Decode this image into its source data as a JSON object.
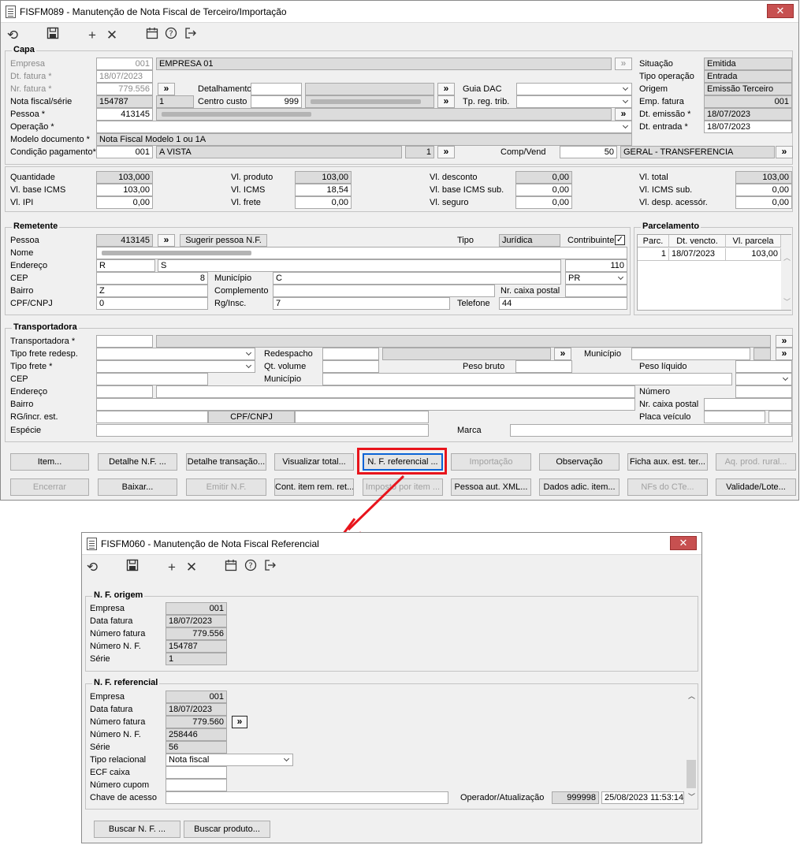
{
  "main_window": {
    "title": "FISFM089 - Manutenção de Nota Fiscal de Terceiro/Importação",
    "close_label": "✕",
    "toolbar": [
      "undo-icon",
      "save-icon",
      "add-icon",
      "delete-icon",
      "calendar-icon",
      "help-icon",
      "exit-icon"
    ],
    "capa": {
      "label": "Capa",
      "empresa_label": "Empresa",
      "empresa": "001",
      "empresa_nome": "EMPRESA 01",
      "dt_fatura_label": "Dt. fatura *",
      "dt_fatura": "18/07/2023",
      "nr_fatura_label": "Nr. fatura *",
      "nr_fatura": "779.556",
      "nota_serie_label": "Nota fiscal/série",
      "nota": "154787",
      "serie": "1",
      "pessoa_label": "Pessoa *",
      "pessoa": "413145",
      "operacao_label": "Operação *",
      "modelo_label": "Modelo documento *",
      "modelo": "Nota Fiscal Modelo 1 ou 1A",
      "condicao_label": "Condição pagamento*",
      "condicao": "001",
      "condicao_nome": "A VISTA",
      "condicao_num": "1",
      "detalhamento_label": "Detalhamento",
      "centro_custo_label": "Centro custo",
      "centro_custo": "999",
      "guia_dac_label": "Guia DAC",
      "tp_reg_trib_label": "Tp. reg. trib.",
      "comp_vend_label": "Comp/Vend",
      "comp_vend": "50",
      "comp_vend_nome": "GERAL - TRANSFERENCIA",
      "situacao_label": "Situação",
      "situacao": "Emitida",
      "tipo_operacao_label": "Tipo operação",
      "tipo_operacao": "Entrada",
      "origem_label": "Origem",
      "origem": "Emissão Terceiro",
      "emp_fatura_label": "Emp. fatura",
      "emp_fatura": "001",
      "dt_emissao_label": "Dt. emissão *",
      "dt_emissao": "18/07/2023",
      "dt_entrada_label": "Dt. entrada *",
      "dt_entrada": "18/07/2023"
    },
    "totais": {
      "quantidade_label": "Quantidade",
      "quantidade": "103,000",
      "base_icms_label": "Vl. base ICMS",
      "base_icms": "103,00",
      "ipi_label": "Vl. IPI",
      "ipi": "0,00",
      "produto_label": "Vl. produto",
      "produto": "103,00",
      "icms_label": "Vl. ICMS",
      "icms": "18,54",
      "frete_label": "Vl. frete",
      "frete": "0,00",
      "desconto_label": "Vl. desconto",
      "desconto": "0,00",
      "base_icms_sub_label": "Vl. base ICMS sub.",
      "base_icms_sub": "0,00",
      "seguro_label": "Vl. seguro",
      "seguro": "0,00",
      "total_label": "Vl. total",
      "total": "103,00",
      "icms_sub_label": "Vl. ICMS sub.",
      "icms_sub": "0,00",
      "desp_label": "Vl. desp. acessór.",
      "desp": "0,00"
    },
    "remetente": {
      "label": "Remetente",
      "pessoa_label": "Pessoa",
      "pessoa": "413145",
      "sugerir": "Sugerir pessoa N.F.",
      "tipo_label": "Tipo",
      "tipo": "Jurídica",
      "contribuinte_label": "Contribuinte",
      "contribuinte_check": "✓",
      "nome_label": "Nome",
      "nome": "N",
      "endereco_label": "Endereço",
      "endereco": "R",
      "endereco2": "S",
      "numero": "110",
      "cep_label": "CEP",
      "cep": "8",
      "municipio_label": "Município",
      "municipio": "C",
      "uf": "PR",
      "bairro_label": "Bairro",
      "bairro": "Z",
      "complemento_label": "Complemento",
      "caixa_postal_label": "Nr. caixa postal",
      "cpf_label": "CPF/CNPJ",
      "cpf": "0",
      "rg_label": "Rg/Insc.",
      "rg": "7",
      "telefone_label": "Telefone",
      "telefone": "44"
    },
    "parcelamento": {
      "label": "Parcelamento",
      "headers": [
        "Parc.",
        "Dt. vencto.",
        "Vl. parcela"
      ],
      "rows": [
        [
          "1",
          "18/07/2023",
          "103,00"
        ]
      ]
    },
    "transportadora": {
      "label": "Transportadora",
      "transportadora_label": "Transportadora *",
      "tipo_frete_redesp_label": "Tipo frete redesp.",
      "tipo_frete_label": "Tipo frete *",
      "cep_label": "CEP",
      "endereco_label": "Endereço",
      "bairro_label": "Bairro",
      "rg_label": "RG/incr. est.",
      "cpf_label": "CPF/CNPJ",
      "especie_label": "Espécie",
      "redespacho_label": "Redespacho",
      "municipio_label": "Município",
      "qt_volume_label": "Qt. volume",
      "peso_bruto_label": "Peso bruto",
      "peso_liquido_label": "Peso líquido",
      "municipio2_label": "Município",
      "numero_label": "Número",
      "caixa_postal_label": "Nr. caixa postal",
      "placa_label": "Placa veículo",
      "marca_label": "Marca"
    },
    "buttons_row1": [
      "Item...",
      "Detalhe N.F. ...",
      "Detalhe transação...",
      "Visualizar total...",
      "N. F. referencial ...",
      "Importação",
      "Observação",
      "Ficha aux. est. ter...",
      "Aq. prod. rural..."
    ],
    "buttons_row2": [
      "Encerrar",
      "Baixar...",
      "Emitir N.F.",
      "Cont. item rem. ret...",
      "Imposto por item ...",
      "Pessoa aut. XML...",
      "Dados adic. item...",
      "NFs do CTe...",
      "Validade/Lote..."
    ]
  },
  "child_window": {
    "title": "FISFM060 - Manutenção de Nota Fiscal Referencial",
    "close_label": "✕",
    "origem": {
      "label": "N. F. origem",
      "empresa_label": "Empresa",
      "empresa": "001",
      "data_fatura_label": "Data fatura",
      "data_fatura": "18/07/2023",
      "numero_fatura_label": "Número fatura",
      "numero_fatura": "779.556",
      "numero_nf_label": "Número N. F.",
      "numero_nf": "154787",
      "serie_label": "Série",
      "serie": "1"
    },
    "referencial": {
      "label": "N. F. referencial",
      "empresa_label": "Empresa",
      "empresa": "001",
      "data_fatura_label": "Data fatura",
      "data_fatura": "18/07/2023",
      "numero_fatura_label": "Número fatura",
      "numero_fatura": "779.560",
      "numero_nf_label": "Número N. F.",
      "numero_nf": "258446",
      "serie_label": "Série",
      "serie": "56",
      "tipo_relacional_label": "Tipo relacional",
      "tipo_relacional": "Nota fiscal",
      "ecf_caixa_label": "ECF caixa",
      "numero_cupom_label": "Número cupom",
      "chave_acesso_label": "Chave de acesso",
      "operador_label": "Operador/Atualização",
      "operador": "999998",
      "atualizacao": "25/08/2023 11:53:14"
    },
    "buscar_nf": "Buscar N. F. ...",
    "buscar_produto": "Buscar produto..."
  },
  "highlight_color": "#e8141c",
  "accent_color": "#0a64d6"
}
